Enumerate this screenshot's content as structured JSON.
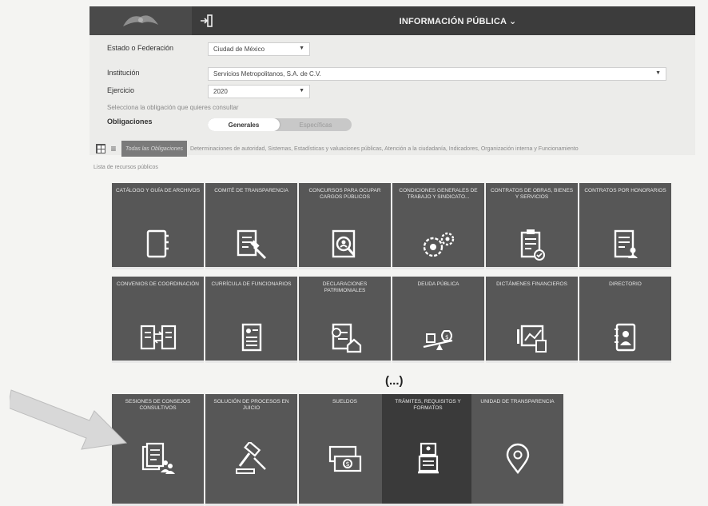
{
  "header": {
    "title": "INFORMACIÓN PÚBLICA",
    "title_caret": "⌄",
    "logo_icon": "eagle-logo-icon",
    "login_icon": "login-icon"
  },
  "form": {
    "estado_label": "Estado o Federación",
    "estado_value": "Ciudad de México",
    "institucion_label": "Institución",
    "institucion_value": "Servicios Metropolitanos, S.A. de C.V.",
    "ejercicio_label": "Ejercicio",
    "ejercicio_value": "2020",
    "hint": "Selecciona la obligación que quieres consultar",
    "obligaciones_label": "Obligaciones",
    "toggle_generales": "Generales",
    "toggle_especificas": "Específicas"
  },
  "filters": {
    "badge": "Todas las Obligaciones",
    "description": "Determinaciones de autoridad, Sistemas, Estadísticas y valuaciones públicas, Atención a la ciudadanía, Indicadores, Organización interna y Funcionamiento",
    "subtitle": "Lista de recursos públicos"
  },
  "tiles_row1": [
    {
      "label": "CATÁLOGO Y GUÍA DE ARCHIVOS",
      "icon": "archive-folder-icon"
    },
    {
      "label": "COMITÉ DE TRANSPARENCIA",
      "icon": "document-gavel-icon"
    },
    {
      "label": "CONCURSOS PARA OCUPAR CARGOS PÚBLICOS",
      "icon": "search-person-document-icon"
    },
    {
      "label": "CONDICIONES GENERALES DE TRABAJO Y SINDICATO...",
      "icon": "gears-person-icon"
    },
    {
      "label": "CONTRATOS DE OBRAS, BIENES Y SERVICIOS",
      "icon": "clipboard-check-icon"
    },
    {
      "label": "CONTRATOS POR HONORARIOS",
      "icon": "document-person-icon"
    }
  ],
  "tiles_row2": [
    {
      "label": "CONVENIOS DE COORDINACIÓN",
      "icon": "documents-exchange-icon"
    },
    {
      "label": "CURRÍCULA DE FUNCIONARIOS",
      "icon": "resume-icon"
    },
    {
      "label": "DECLARACIONES PATRIMONIALES",
      "icon": "declaration-house-icon"
    },
    {
      "label": "DEUDA PÚBLICA",
      "icon": "scale-money-icon"
    },
    {
      "label": "DICTÁMENES FINANCIEROS",
      "icon": "chart-calculator-icon"
    },
    {
      "label": "DIRECTORIO",
      "icon": "address-book-icon"
    }
  ],
  "ellipsis": "(...)",
  "tiles_row3": [
    {
      "label": "SESIONES DE CONSEJOS CONSULTIVOS",
      "icon": "documents-people-icon"
    },
    {
      "label": "SOLUCIÓN DE PROCESOS EN JUICIO",
      "icon": "gavel-icon"
    },
    {
      "label": "SUELDOS",
      "icon": "banknotes-icon"
    },
    {
      "label": "TRÁMITES, REQUISITOS Y FORMATOS",
      "icon": "kiosk-icon"
    },
    {
      "label": "UNIDAD DE TRANSPARENCIA",
      "icon": "location-pin-icon"
    }
  ],
  "colors": {
    "topbar": "#3c3c3c",
    "tile": "#575757",
    "tile_dark": "#3a3a3a",
    "arrow": "#d6d6d6"
  }
}
